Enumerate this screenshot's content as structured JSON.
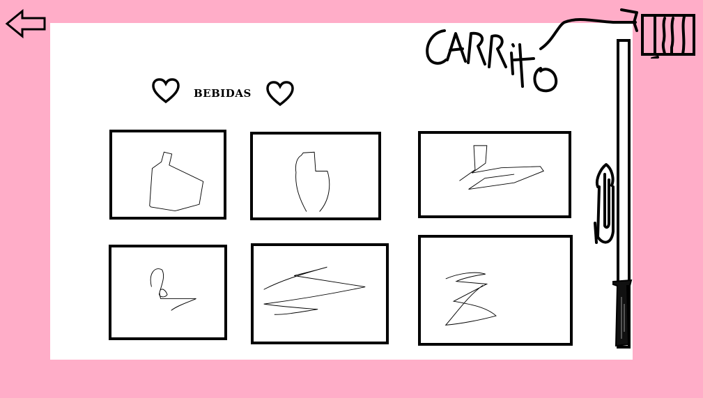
{
  "header": {
    "back_icon": "arrow-left-icon",
    "title": "BEBIDAS",
    "heart_icon": "heart-icon"
  },
  "cart": {
    "label": "CARRito",
    "icon": "cart-icon"
  },
  "products": [
    {
      "id": 1,
      "icon": "bottle-sketch"
    },
    {
      "id": 2,
      "icon": "bottle-sketch"
    },
    {
      "id": 3,
      "icon": "scribble-sketch"
    },
    {
      "id": 4,
      "icon": "scribble-sketch"
    },
    {
      "id": 5,
      "icon": "scribble-sketch"
    },
    {
      "id": 6,
      "icon": "scribble-sketch"
    }
  ],
  "colors": {
    "background": "#ffadc8",
    "panel": "#ffffff",
    "ink": "#000000"
  }
}
